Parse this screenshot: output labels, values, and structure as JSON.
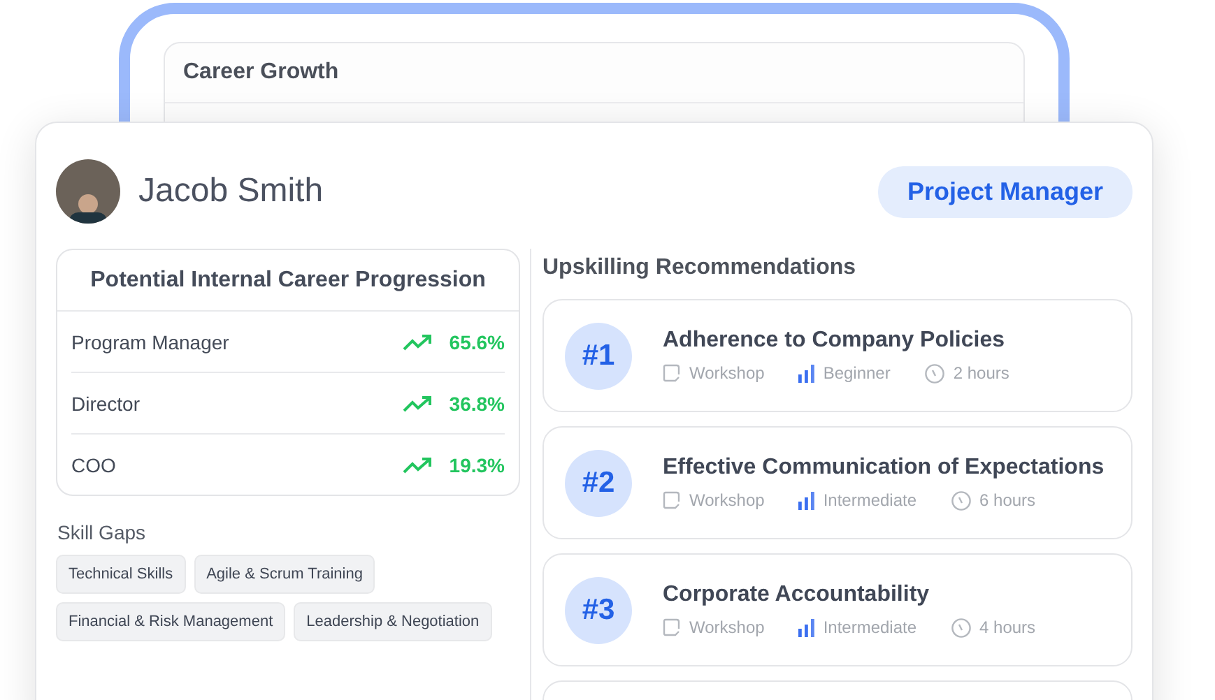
{
  "background_panel": {
    "title": "Career Growth"
  },
  "profile": {
    "name": "Jacob Smith",
    "role": "Project Manager"
  },
  "progression": {
    "title": "Potential Internal Career Progression",
    "rows": [
      {
        "role": "Program Manager",
        "percent": "65.6%"
      },
      {
        "role": "Director",
        "percent": "36.8%"
      },
      {
        "role": "COO",
        "percent": "19.3%"
      }
    ]
  },
  "skill_gaps": {
    "title": "Skill Gaps",
    "tags": [
      "Technical Skills",
      "Agile & Scrum Training",
      "Financial & Risk Management",
      "Leadership & Negotiation"
    ]
  },
  "recommendations": {
    "title": "Upskilling Recommendations",
    "items": [
      {
        "rank": "#1",
        "title": "Adherence to Company Policies",
        "format": "Workshop",
        "level": "Beginner",
        "duration": "2 hours"
      },
      {
        "rank": "#2",
        "title": "Effective Communication of Expectations",
        "format": "Workshop",
        "level": "Intermediate",
        "duration": "6 hours"
      },
      {
        "rank": "#3",
        "title": "Corporate Accountability",
        "format": "Workshop",
        "level": "Intermediate",
        "duration": "4 hours"
      }
    ]
  }
}
